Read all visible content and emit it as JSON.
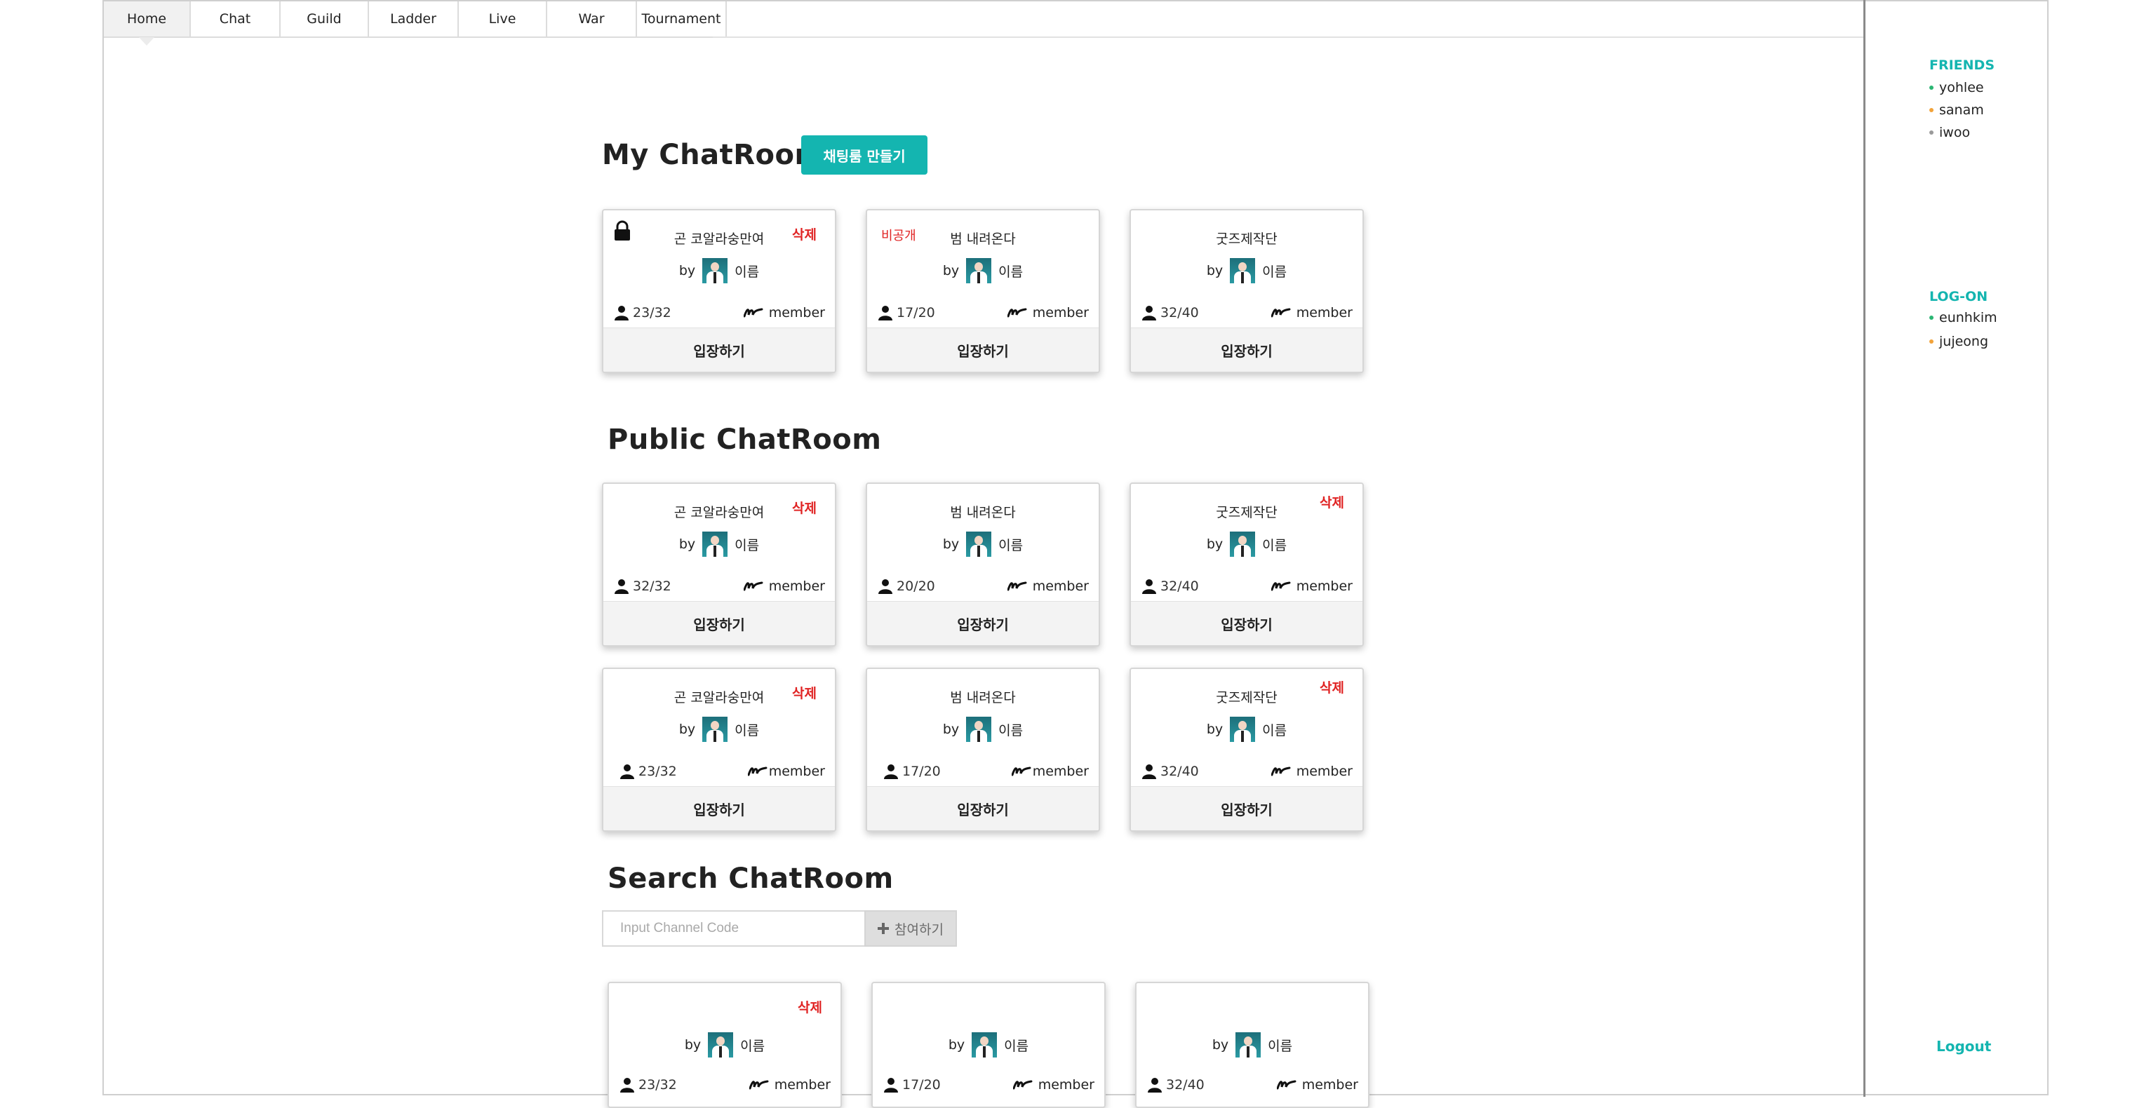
{
  "nav": {
    "tabs": [
      {
        "label": "Home"
      },
      {
        "label": "Chat"
      },
      {
        "label": "Guild"
      },
      {
        "label": "Ladder"
      },
      {
        "label": "Live"
      },
      {
        "label": "War"
      },
      {
        "label": "Tournament"
      }
    ],
    "active": "Home"
  },
  "my_chatroom": {
    "title": "My ChatRoom",
    "create_button": "채팅룸 만들기",
    "cards": [
      {
        "title": "곤 코알라숭만여",
        "by": "by",
        "owner": "이름",
        "count": "23/32",
        "member": "member",
        "enter": "입장하기",
        "badge": "삭제",
        "locked": true
      },
      {
        "title": "범 내려온다",
        "by": "by",
        "owner": "이름",
        "count": "17/20",
        "member": "member",
        "enter": "입장하기",
        "badge": "비공개"
      },
      {
        "title": "굿즈제작단",
        "by": "by",
        "owner": "이름",
        "count": "32/40",
        "member": "member",
        "enter": "입장하기"
      }
    ]
  },
  "public_chatroom": {
    "title": "Public ChatRoom",
    "cards": [
      {
        "title": "곤 코알라숭만여",
        "by": "by",
        "owner": "이름",
        "count": "32/32",
        "member": "member",
        "enter": "입장하기",
        "badge": "삭제"
      },
      {
        "title": "범 내려온다",
        "by": "by",
        "owner": "이름",
        "count": "20/20",
        "member": "member",
        "enter": "입장하기"
      },
      {
        "title": "굿즈제작단",
        "by": "by",
        "owner": "이름",
        "count": "32/40",
        "member": "member",
        "enter": "입장하기",
        "badge": "삭제"
      },
      {
        "title": "곤 코알라숭만여",
        "by": "by",
        "owner": "이름",
        "count": "23/32",
        "member": "member",
        "enter": "입장하기",
        "badge": "삭제"
      },
      {
        "title": "범 내려온다",
        "by": "by",
        "owner": "이름",
        "count": "17/20",
        "member": "member",
        "enter": "입장하기"
      },
      {
        "title": "굿즈제작단",
        "by": "by",
        "owner": "이름",
        "count": "32/40",
        "member": "member",
        "enter": "입장하기",
        "badge": "삭제"
      }
    ]
  },
  "search_chatroom": {
    "title": "Search ChatRoom",
    "input_placeholder": "Input Channel Code",
    "join_button": "참여하기",
    "cards": [
      {
        "by": "by",
        "owner": "이름",
        "count": "23/32",
        "member": "member",
        "badge": "삭제"
      },
      {
        "by": "by",
        "owner": "이름",
        "count": "17/20",
        "member": "member"
      },
      {
        "by": "by",
        "owner": "이름",
        "count": "32/40",
        "member": "member"
      }
    ]
  },
  "sidebar": {
    "friends_heading": "FRIENDS",
    "friends": [
      {
        "name": "yohlee",
        "status_color": "#2bb673"
      },
      {
        "name": "sanam",
        "status_color": "#f2a33a"
      },
      {
        "name": "iwoo",
        "status_color": "#9a9a9a"
      }
    ],
    "logon_heading": "LOG-ON",
    "logon": [
      {
        "name": "eunhkim",
        "status_color": "#2bb673"
      },
      {
        "name": "jujeong",
        "status_color": "#f2a33a"
      }
    ],
    "logout": "Logout"
  },
  "colors": {
    "accent": "#14b5b0",
    "danger": "#e02323"
  }
}
